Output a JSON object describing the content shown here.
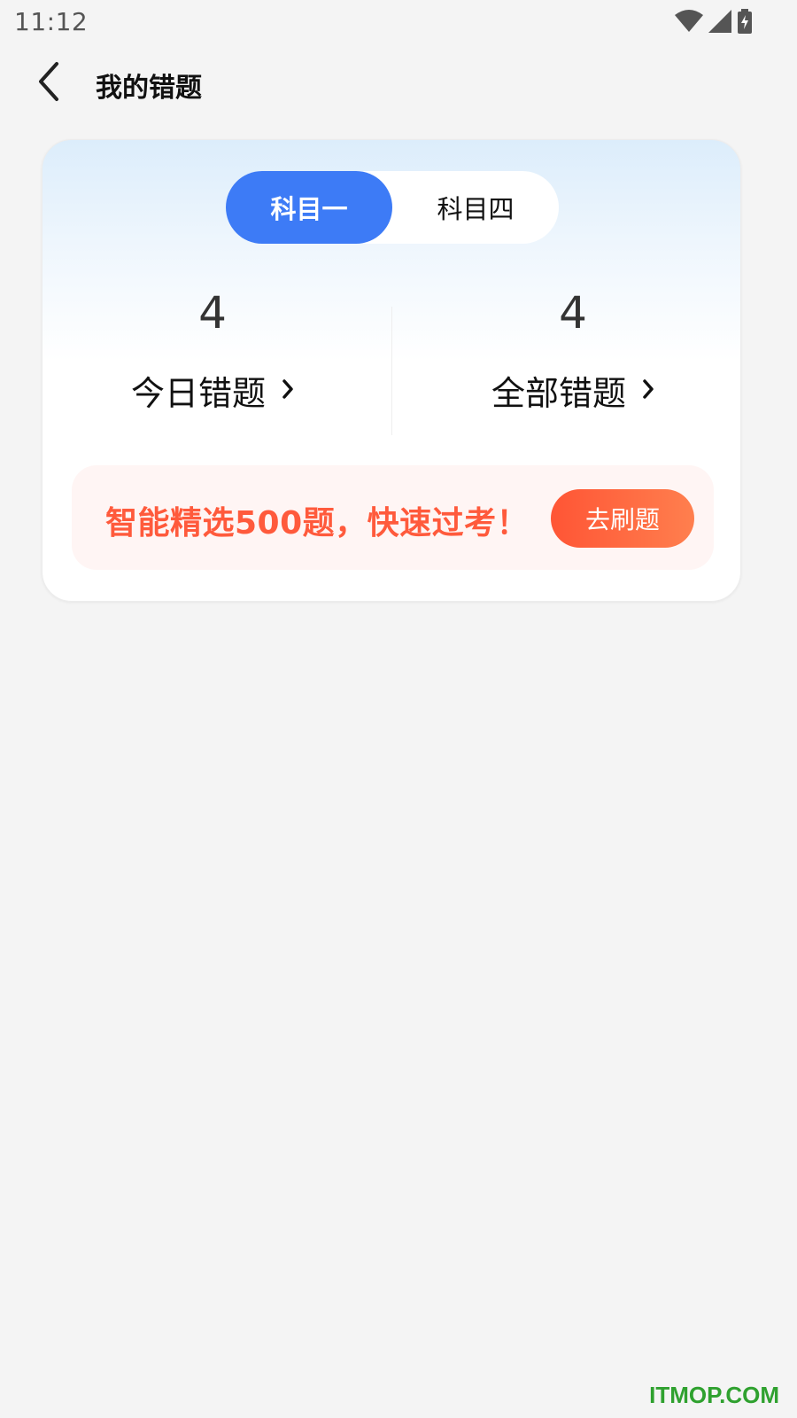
{
  "status_bar": {
    "time": "11:12",
    "icons": [
      "wifi-icon",
      "signal-icon",
      "battery-charging-icon"
    ]
  },
  "header": {
    "back_icon": "chevron-left-icon",
    "title": "我的错题"
  },
  "subject_tabs": [
    {
      "label": "科目一",
      "selected": true
    },
    {
      "label": "科目四",
      "selected": false
    }
  ],
  "stats": {
    "today": {
      "count": "4",
      "label": "今日错题",
      "icon": "chevron-right-icon"
    },
    "all": {
      "count": "4",
      "label": "全部错题",
      "icon": "chevron-right-icon"
    }
  },
  "promo": {
    "text": "智能精选500题，快速过考！",
    "button_label": "去刷题"
  },
  "watermark": "ITMOP.COM",
  "colors": {
    "accent": "#3d7bf6",
    "promo_text": "#ff5a3c",
    "promo_button_start": "#ff5535",
    "promo_button_end": "#ff7f4e",
    "background": "#f4f4f4"
  }
}
